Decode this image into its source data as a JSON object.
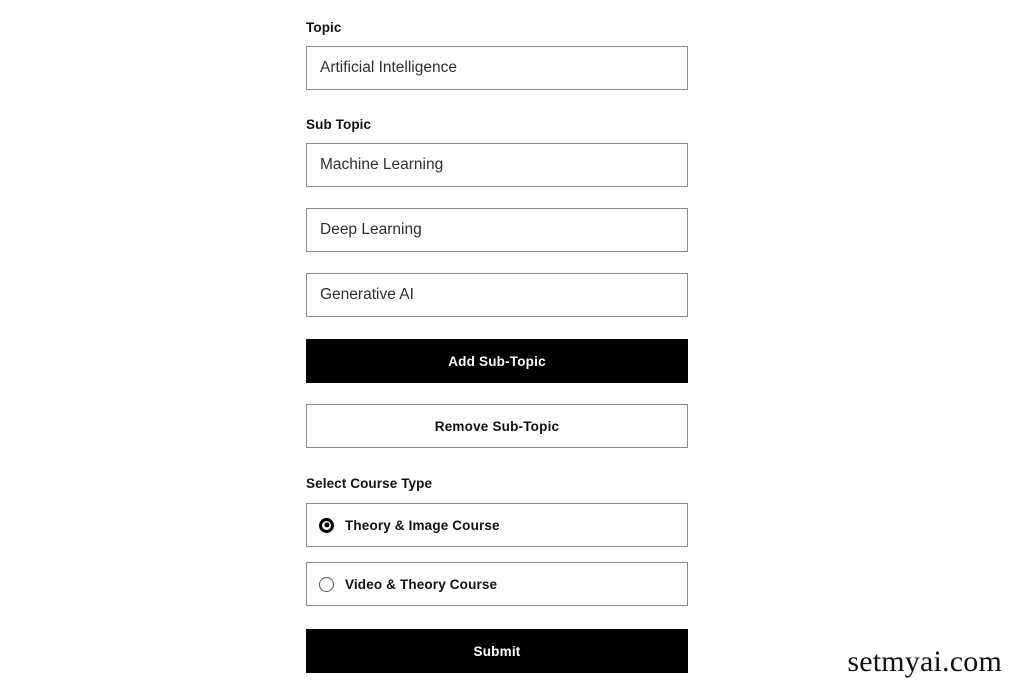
{
  "form": {
    "topic": {
      "label": "Topic",
      "value": "Artificial Intelligence"
    },
    "sub_topic": {
      "label": "Sub Topic",
      "values": [
        "Machine Learning",
        "Deep Learning",
        "Generative AI"
      ]
    },
    "buttons": {
      "add_sub_topic": "Add Sub-Topic",
      "remove_sub_topic": "Remove Sub-Topic",
      "submit": "Submit"
    },
    "course_type": {
      "label": "Select Course Type",
      "options": [
        {
          "label": "Theory & Image Course",
          "selected": true
        },
        {
          "label": "Video & Theory Course",
          "selected": false
        }
      ]
    }
  },
  "watermark": {
    "text": "setmyai.com"
  },
  "colors": {
    "page_background": "#ffffff",
    "border": "#8a8a8a",
    "primary_button_bg": "#000000",
    "primary_button_text": "#ffffff",
    "label_text": "#111111",
    "input_text": "#2f2f2f"
  }
}
